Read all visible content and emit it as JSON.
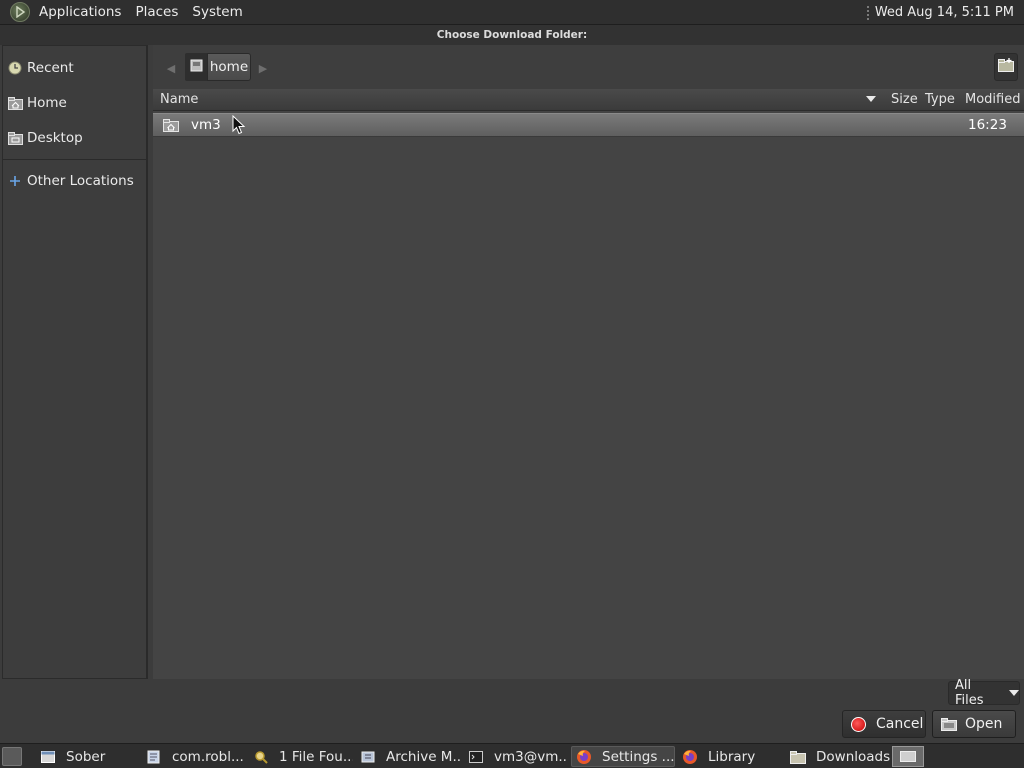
{
  "top_panel": {
    "menus": [
      "Applications",
      "Places",
      "System"
    ],
    "clock": "Wed Aug 14,  5:11 PM"
  },
  "dialog": {
    "title": "Choose Download Folder:",
    "sidebar": {
      "items": [
        {
          "label": "Recent",
          "icon": "clock-icon"
        },
        {
          "label": "Home",
          "icon": "home-folder-icon"
        },
        {
          "label": "Desktop",
          "icon": "desktop-folder-icon"
        },
        {
          "label": "Other Locations",
          "icon": "plus-icon"
        }
      ]
    },
    "pathbar": {
      "crumb": "home"
    },
    "columns": {
      "name": "Name",
      "size": "Size",
      "type": "Type",
      "modified": "Modified"
    },
    "files": [
      {
        "name": "vm3",
        "size": "",
        "type": "",
        "modified": "16:23",
        "icon": "home-folder-icon",
        "selected": true
      }
    ],
    "filter": "All Files",
    "buttons": {
      "cancel": "Cancel",
      "open": "Open"
    }
  },
  "taskbar": {
    "tasks": [
      {
        "label": "Sober",
        "icon": "window-icon"
      },
      {
        "label": "com.robl...",
        "icon": "text-editor-icon"
      },
      {
        "label": "1 File Fou...",
        "icon": "search-icon"
      },
      {
        "label": "Archive M...",
        "icon": "archive-icon"
      },
      {
        "label": "vm3@vm...",
        "icon": "terminal-icon"
      },
      {
        "label": "Settings ...",
        "icon": "firefox-icon",
        "active": true
      },
      {
        "label": "Library",
        "icon": "firefox-icon"
      },
      {
        "label": "Downloads",
        "icon": "folder-icon"
      }
    ]
  }
}
